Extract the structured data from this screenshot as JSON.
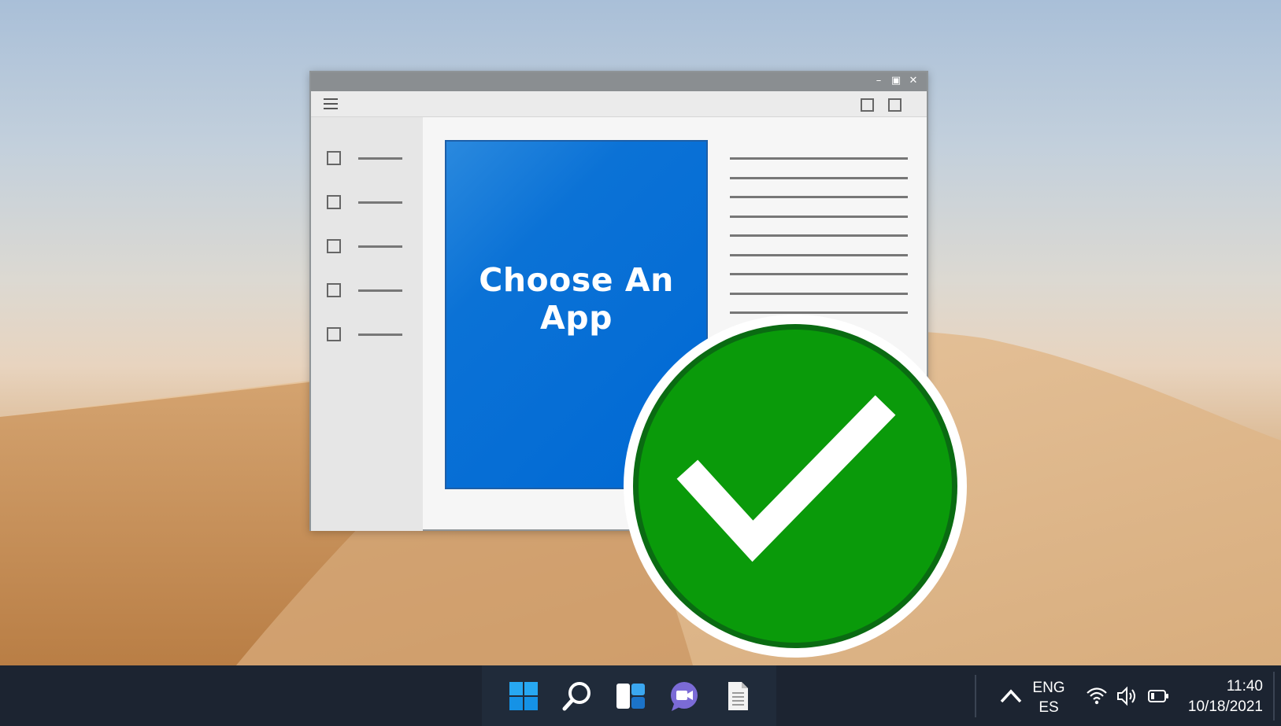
{
  "window": {
    "card_title": "Choose An App",
    "sidebar_item_count": 5,
    "controls": {
      "minimize": "–",
      "maximize": "▣",
      "close": "✕"
    }
  },
  "badge": {
    "icon": "checkmark-icon",
    "color": "#0a9a0a"
  },
  "taskbar": {
    "apps": [
      {
        "name": "start",
        "icon": "windows-logo-icon"
      },
      {
        "name": "search",
        "icon": "search-icon"
      },
      {
        "name": "widgets",
        "icon": "widgets-icon"
      },
      {
        "name": "chat",
        "icon": "chat-camera-icon"
      },
      {
        "name": "file",
        "icon": "document-icon"
      }
    ],
    "language": {
      "primary": "ENG",
      "secondary": "ES"
    },
    "clock": {
      "time": "11:40",
      "date": "10/18/2021"
    }
  }
}
